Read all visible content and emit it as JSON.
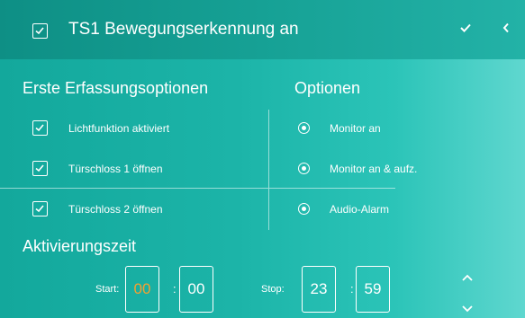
{
  "colors": {
    "accent_orange": "#f5a030",
    "text": "#ffffff"
  },
  "header": {
    "title": "TS1 Bewegungserkennung an",
    "checked": true,
    "confirm_icon": "checkmark-icon",
    "back_icon": "chevron-left-icon"
  },
  "capture_options": {
    "title": "Erste Erfassungsoptionen",
    "items": [
      {
        "label": "Lichtfunktion aktiviert",
        "checked": true
      },
      {
        "label": "Türschloss 1 öffnen",
        "checked": true
      },
      {
        "label": "Türschloss 2 öffnen",
        "checked": true
      }
    ]
  },
  "options": {
    "title": "Optionen",
    "items": [
      {
        "label": "Monitor an",
        "selected": true
      },
      {
        "label": "Monitor an & aufz.",
        "selected": true
      },
      {
        "label": "Audio-Alarm",
        "selected": true
      }
    ]
  },
  "activation": {
    "title": "Aktivierungszeit",
    "start_label": "Start:",
    "start_hour": "00",
    "start_minute": "00",
    "stop_label": "Stop:",
    "stop_hour": "23",
    "stop_minute": "59",
    "separator": ":",
    "up_icon": "chevron-up-icon",
    "down_icon": "chevron-down-icon"
  }
}
